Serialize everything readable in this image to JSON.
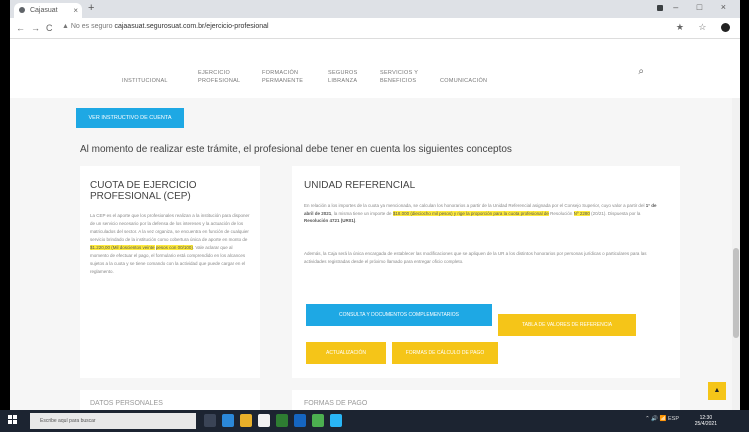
{
  "browser": {
    "tab_title": "Cajasuat",
    "tab_close": "×",
    "new_tab": "+",
    "nav_buttons": "←→C",
    "url_prefix": "▲ No es seguro",
    "url": "cajaasuat.segurosuat.com.br/ejercicio-profesional",
    "window_controls": "– □ ×",
    "tools_icons": "★ ☆"
  },
  "site_nav": {
    "items": [
      {
        "label": "INSTITUCIONAL"
      },
      {
        "label": "EJERCICIO PROFESIONAL"
      },
      {
        "label": "FORMACIÓN PERMANENTE"
      },
      {
        "label": "SEGUROS LIBRANZA"
      },
      {
        "label": "SERVICIOS Y BENEFICIOS"
      },
      {
        "label": "COMUNICACIÓN"
      }
    ],
    "search_icon": "⌕"
  },
  "content": {
    "instr_button": "VER INSTRUCTIVO DE CUENTA",
    "intro": "Al momento de realizar este trámite, el profesional debe tener en cuenta los siguientes conceptos",
    "left_card": {
      "title": "CUOTA DE EJERCICIO PROFESIONAL (CEP)",
      "text_a": "La CEP es el aporte que los profesionales realizan a la institución para disponer de un servicio necesario por la defensa de los intereses y la actuación de los matriculados del sector. A la vez organiza, se encuentra en función de cualquier servicio brindado de la institución como cobertura única de aporte en monto de ",
      "highlight_1": "$1.220,00 (Mil doscientos veinte",
      "highlight_2": "pesos con 00/100)",
      "text_b": ". Vale aclarar que al momento de efectuar el pago, el formulario está comprendido en los alcances sujetos a la cuota y se tiene comando con la actividad que puede cargar en el reglamento."
    },
    "right_card": {
      "title": "UNIDAD REFERENCIAL",
      "p1_a": "En relación a los importes de la cuota ya mencionada, se calculan los honorarios a partir de la Unidad Referencial asignada por el Consejo Superior, cuyo valor a partir del ",
      "p1_date": "1° de abril de 2021",
      "p1_b": ", la misma tiene un importe de ",
      "p1_hl": "$18.000 (dieciocho mil pesos) y rige la proporción para la cuota profesional de",
      "p1_c": " Resolución ",
      "p1_hl2": "Nº 2280",
      "p1_d": " (20/21). Dispuesta por la ",
      "p1_res": "Resolución 4721 (UR01)",
      "p1_e": ".",
      "p2": "Además, la Caja será la única encargada de establecer las modificaciones que se apliquen de la UR a los distintos honorarios por personas jurídicas o particulares para las actividades registradas desde el próximo llamado para entregar oficio completo."
    },
    "buttons": {
      "b1": "CONSULTA Y DOCUMENTOS COMPLEMENTARIOS",
      "b2": "TABLA DE VALORES DE REFERENCIA",
      "b3": "ACTUALIZACIÓN",
      "b4": "FORMAS DE CÁLCULO DE PAGO"
    },
    "left_card2_title": "DATOS PERSONALES",
    "right_card2_title": "FORMAS DE PAGO",
    "back_to_top": "▲"
  },
  "taskbar": {
    "search_placeholder": "Escribe aquí para buscar",
    "tray_text": "⌃ 🔊 📶 ESP",
    "clock_time": "12:30",
    "clock_date": "25/4/2021"
  },
  "colors": {
    "accent_blue": "#1ea8e4",
    "accent_yellow": "#f5c518",
    "highlight": "#ffeb3b"
  }
}
